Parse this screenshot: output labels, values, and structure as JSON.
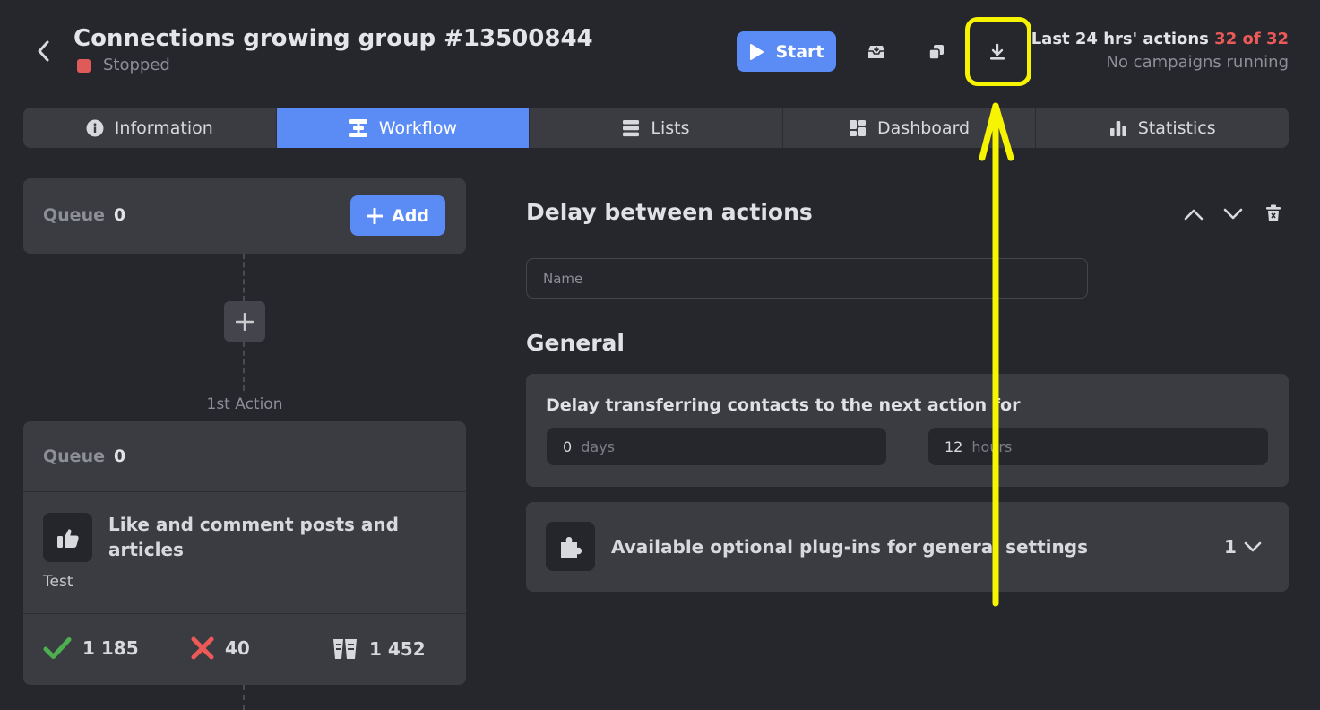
{
  "header": {
    "title": "Connections growing group #13500844",
    "status": "Stopped",
    "start_label": "Start",
    "limit_prefix": "Last 24 hrs' actions",
    "limit_value": "32 of 32",
    "campaigns": "No campaigns running",
    "icons": [
      "back-chevron-icon",
      "play-icon",
      "archive-icon",
      "copy-icon",
      "download-icon"
    ]
  },
  "tabs": [
    {
      "label": "Information",
      "icon": "info-icon"
    },
    {
      "label": "Workflow",
      "icon": "workflow-icon",
      "active": true
    },
    {
      "label": "Lists",
      "icon": "list-icon"
    },
    {
      "label": "Dashboard",
      "icon": "dashboard-icon"
    },
    {
      "label": "Statistics",
      "icon": "bar-chart-icon"
    }
  ],
  "queue_card": {
    "label": "Queue",
    "count": "0",
    "add_label": "Add"
  },
  "first_action_label": "1st Action",
  "action_card": {
    "queue_label": "Queue",
    "queue_count": "0",
    "title": "Like and comment posts and articles",
    "subtitle": "Test",
    "stats": {
      "success": "1 185",
      "failed": "40",
      "total": "1 452"
    }
  },
  "settings": {
    "title": "Delay between actions",
    "name_placeholder": "Name",
    "general_title": "General",
    "delay_label": "Delay transferring contacts to the next action for",
    "days_value": "0",
    "days_unit": "days",
    "hours_value": "12",
    "hours_unit": "hours",
    "plugins_label": "Available optional plug-ins for general settings",
    "plugins_count": "1"
  },
  "colors": {
    "accent": "#5b8bf5",
    "background": "#26272c",
    "card": "#3b3c42",
    "danger": "#ec5a57",
    "success": "#4cb04f",
    "annotation": "#f6f400"
  }
}
